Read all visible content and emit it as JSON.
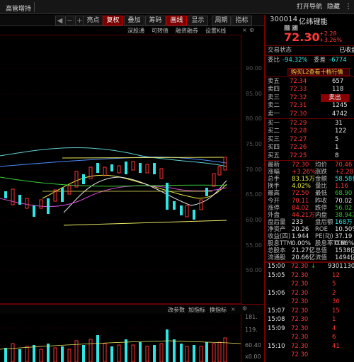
{
  "window": {
    "title": "高管增持",
    "actions": [
      "打开导航",
      "隐藏"
    ],
    "window_controls": [
      "minimize-icon",
      "maximize-icon",
      "close-icon"
    ]
  },
  "toolbar": {
    "items": [
      {
        "label": "◀",
        "icon": "arrow-left-icon"
      },
      {
        "label": "−",
        "icon": "zoom-out-icon"
      },
      {
        "label": "+",
        "icon": "zoom-in-icon"
      },
      {
        "label": "⋯",
        "icon": "more-icon"
      },
      {
        "label": "亮点"
      },
      {
        "label": "复权",
        "highlighted": true
      },
      {
        "label": "叠加"
      },
      {
        "label": "筹码"
      },
      {
        "label": "画线",
        "highlighted": true
      },
      {
        "label": "显示"
      },
      {
        "label": "周期"
      },
      {
        "label": "指标"
      }
    ]
  },
  "subbar": {
    "items": [
      "深股通",
      "可转债",
      "融资融券",
      "设置K线"
    ]
  },
  "price_axis": {
    "ticks": [
      "90.00",
      "85.00",
      "80.00",
      "75.00",
      "70.00",
      "65.00",
      "60.00",
      "55.00",
      "50.00"
    ]
  },
  "volume_header": {
    "items": [
      "改参数",
      "加指标",
      "换指标"
    ]
  },
  "volume_axis": {
    "ticks": [
      "181.",
      "119.",
      "60.40",
      "x0.00"
    ]
  },
  "quote": {
    "code": "300014",
    "name": "亿纬锂能",
    "tags": [
      "融",
      "通"
    ],
    "price": "72.30",
    "change": "+2.28",
    "change_pct": "+3.26%",
    "status_label": "交易状态",
    "status_value": "已收盘",
    "webi_label": "委比",
    "webi_value": "-94.32%",
    "weicha_label": "委差",
    "weicha_value": "-6774",
    "l2_banner": "购买L2查看十档行情",
    "sell_levels": [
      {
        "label": "卖五",
        "price": "72.34",
        "vol": "657"
      },
      {
        "label": "卖四",
        "price": "72.33",
        "vol": "118"
      },
      {
        "label": "卖三",
        "price": "72.32",
        "vol": "卖出"
      },
      {
        "label": "卖二",
        "price": "72.31",
        "vol": "1245"
      },
      {
        "label": "卖一",
        "price": "72.30",
        "vol": "4742"
      }
    ],
    "buy_levels": [
      {
        "label": "买一",
        "price": "72.29",
        "vol": "31"
      },
      {
        "label": "买二",
        "price": "72.28",
        "vol": "122"
      },
      {
        "label": "买三",
        "price": "72.27",
        "vol": "5"
      },
      {
        "label": "买四",
        "price": "72.26",
        "vol": "1"
      },
      {
        "label": "买五",
        "price": "72.25",
        "vol": "8"
      }
    ],
    "stats": [
      {
        "l1": "最新",
        "v1": "72.30",
        "c1": "red",
        "l2": "均价",
        "v2": "70.46",
        "c2": "red"
      },
      {
        "l1": "涨幅",
        "v1": "+3.26%",
        "c1": "red",
        "l2": "涨跌",
        "v2": "+2.28",
        "c2": "red"
      },
      {
        "l1": "总手",
        "v1": "83.15万",
        "c1": "yel",
        "l2": "金额",
        "v2": "58.58亿",
        "c2": "cyan"
      },
      {
        "l1": "换手",
        "v1": "4.02%",
        "c1": "yel",
        "l2": "量比",
        "v2": "1.16",
        "c2": "red"
      },
      {
        "l1": "最高",
        "v1": "72.50",
        "c1": "red",
        "l2": "最低",
        "v2": "68.90",
        "c2": "green"
      },
      {
        "l1": "今开",
        "v1": "70.11",
        "c1": "red",
        "l2": "昨收",
        "v2": "70.02",
        "c2": "wht"
      },
      {
        "l1": "涨停",
        "v1": "84.02",
        "c1": "red",
        "l2": "跌停",
        "v2": "56.02",
        "c2": "green"
      },
      {
        "l1": "外盘",
        "v1": "44.21万",
        "c1": "red",
        "l2": "内盘",
        "v2": "38.94万",
        "c2": "green"
      },
      {
        "l1": "盘后量",
        "v1": "233",
        "c1": "wht",
        "l2": "盘后额",
        "v2": "168万",
        "c2": "cyan"
      },
      {
        "l1": "净资产",
        "v1": "20.26",
        "c1": "wht",
        "l2": "ROE",
        "v2": "10.50%",
        "c2": "wht"
      },
      {
        "l1": "收益(四)",
        "v1": "1.944",
        "c1": "wht",
        "l2": "PE(动)",
        "v2": "37.19",
        "c2": "wht"
      },
      {
        "l1": "股息TTM",
        "v1": "0.00%",
        "c1": "wht",
        "l2": "股息率TTM",
        "v2": "0.66%",
        "c2": "wht"
      },
      {
        "l1": "总股本",
        "v1": "21.27亿",
        "c1": "wht",
        "l2": "总值",
        "v2": "1538亿",
        "c2": "wht"
      },
      {
        "l1": "流通股",
        "v1": "20.66亿",
        "c1": "wht",
        "l2": "流值",
        "v2": "1494亿",
        "c2": "wht"
      }
    ],
    "ticks": [
      {
        "time": "15:00",
        "price": "72.30",
        "arrow": "↓",
        "vol": "9301",
        "extra": "130:"
      },
      {
        "time": "15:05",
        "price": "72.30",
        "arrow": "",
        "vol": "12",
        "extra": ""
      },
      {
        "time": "",
        "price": "72.30",
        "arrow": "",
        "vol": "5",
        "extra": ""
      },
      {
        "time": "15:06",
        "price": "72.30",
        "arrow": "",
        "vol": "2",
        "extra": ""
      },
      {
        "time": "",
        "price": "72.30",
        "arrow": "",
        "vol": "30",
        "extra": ""
      },
      {
        "time": "15:07",
        "price": "72.30",
        "arrow": "",
        "vol": "15",
        "extra": ""
      },
      {
        "time": "15:08",
        "price": "72.30",
        "arrow": "",
        "vol": "1",
        "extra": ""
      },
      {
        "time": "15:09",
        "price": "72.30",
        "arrow": "",
        "vol": "4",
        "extra": ""
      },
      {
        "time": "",
        "price": "72.30",
        "arrow": "",
        "vol": "6",
        "extra": ""
      },
      {
        "time": "15:10",
        "price": "72.30",
        "arrow": "",
        "vol": "41",
        "extra": ""
      },
      {
        "time": "",
        "price": "72.30",
        "arrow": "",
        "vol": "",
        "extra": ""
      }
    ]
  },
  "colors": {
    "up": "#ff3434",
    "down": "#2fe6e6",
    "accent": "#7a0000"
  }
}
